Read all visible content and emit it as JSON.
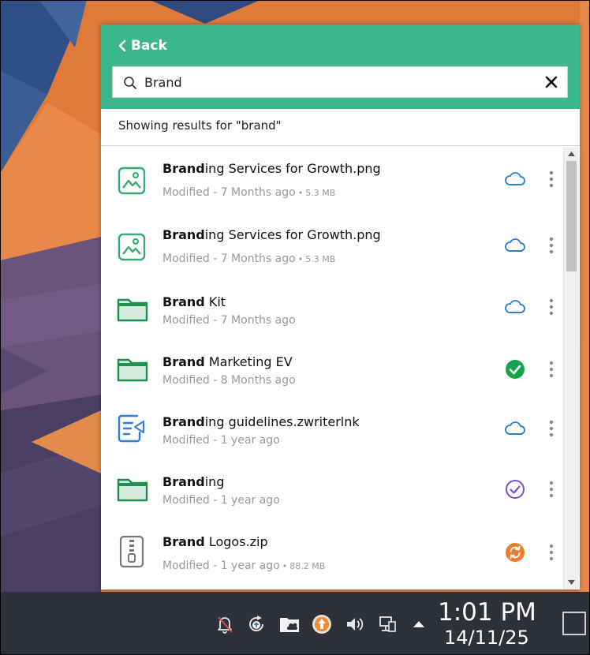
{
  "header": {
    "back_label": "Back"
  },
  "search": {
    "value": "Brand",
    "placeholder": ""
  },
  "results": {
    "label": "Showing results for \"brand\""
  },
  "items": [
    {
      "match": "Brand",
      "rest": "ing Services for Growth.png",
      "modified": "Modified - 7 Months ago",
      "size": "5.3 MB",
      "type": "image",
      "status": "cloud"
    },
    {
      "match": "Brand",
      "rest": "ing Services for Growth.png",
      "modified": "Modified - 7 Months ago",
      "size": "5.3 MB",
      "type": "image",
      "status": "cloud"
    },
    {
      "match": "Brand",
      "rest": " Kit",
      "modified": "Modified - 7 Months ago",
      "size": "",
      "type": "folder",
      "status": "cloud"
    },
    {
      "match": "Brand",
      "rest": " Marketing EV",
      "modified": "Modified - 8 Months ago",
      "size": "",
      "type": "folder",
      "status": "synced"
    },
    {
      "match": "Brand",
      "rest": "ing guidelines.zwriterlnk",
      "modified": "Modified - 1 year ago",
      "size": "",
      "type": "writer",
      "status": "cloud"
    },
    {
      "match": "Brand",
      "rest": "ing",
      "modified": "Modified - 1 year ago",
      "size": "",
      "type": "folder",
      "status": "available"
    },
    {
      "match": "Brand",
      "rest": " Logos.zip",
      "modified": "Modified - 1 year ago",
      "size": "88.2 MB",
      "type": "zip",
      "status": "syncing"
    }
  ],
  "taskbar": {
    "time": "1:01 PM",
    "date": "14/11/25"
  },
  "colors": {
    "header": "#3cb78c",
    "folder": "#1f8f4e",
    "cloud": "#2f7fd6",
    "synced": "#16a34a",
    "available": "#7c4ddb",
    "syncing": "#f07b2c"
  }
}
